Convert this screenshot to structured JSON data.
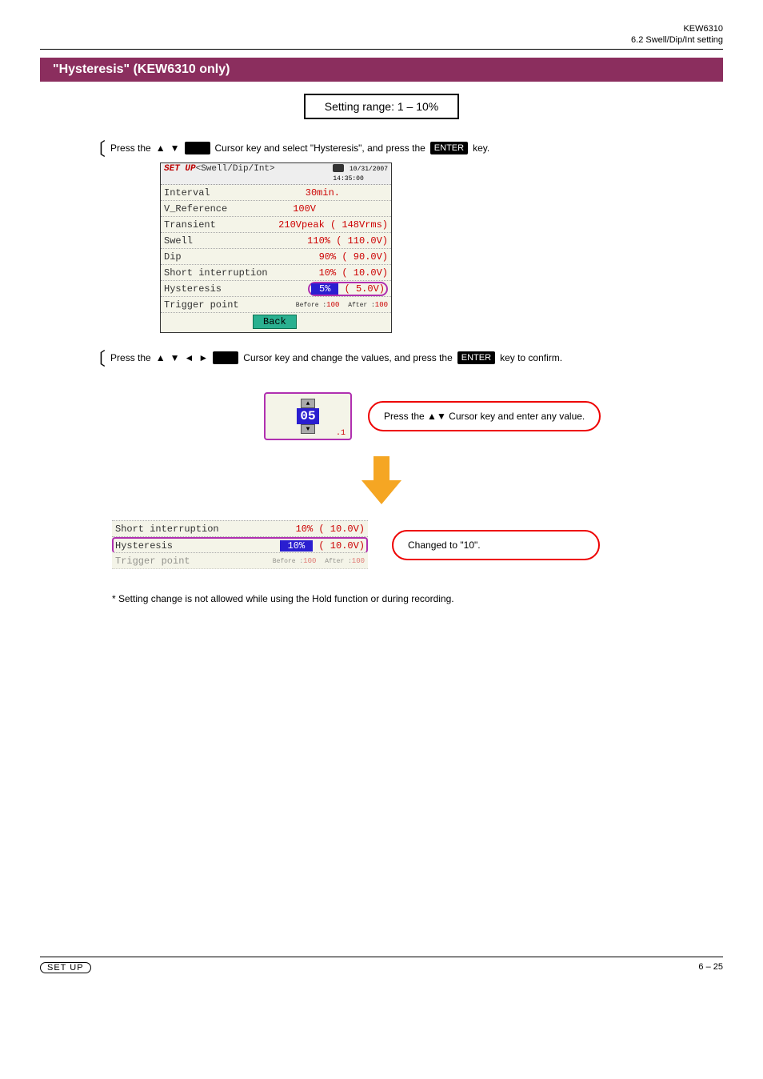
{
  "header": {
    "chapter_right": "KEW6310",
    "breadcrumb_right": "6.2 Swell/Dip/Int setting"
  },
  "section": {
    "title": "\"Hysteresis\" (KEW6310 only)",
    "box_text": "Setting range: 1 – 10%"
  },
  "step1": {
    "text_a": "Press the",
    "text_b": "Cursor key and select \"Hysteresis\", and press the",
    "text_c": "key."
  },
  "lcd1": {
    "title_a": "SET UP",
    "title_b": "<Swell/Dip/Int>",
    "date": "10/31/2007",
    "time": "14:35:00",
    "rows": [
      {
        "name": "Interval",
        "val": "30min."
      },
      {
        "name": "V_Reference",
        "val": "100V"
      },
      {
        "name": "Transient",
        "val": "210Vpeak ( 148Vrms)"
      },
      {
        "name": "Swell",
        "pct": "110%",
        "paren": "( 110.0V)"
      },
      {
        "name": "Dip",
        "pct": "90%",
        "paren": "(  90.0V)"
      },
      {
        "name": "Short interruption",
        "pct": "10%",
        "paren": "(  10.0V)"
      },
      {
        "name": "Hysteresis",
        "pct": "5%",
        "paren": "(   5.0V)"
      },
      {
        "name": "Trigger point",
        "before_lbl": "Before :",
        "before_val": "100",
        "after_lbl": "After :",
        "after_val": "100"
      }
    ],
    "back": "Back"
  },
  "step2": {
    "text_a": "Press the",
    "text_b": "Cursor key and change the values, and press the",
    "text_c": "key to confirm."
  },
  "callout1": {
    "text_a": "Press the",
    "text_b": "Cursor key and enter any value."
  },
  "digit": {
    "value": "05",
    "suffix": ".1"
  },
  "lcd2": {
    "rows": [
      {
        "name": "Short interruption",
        "pct": "10%",
        "paren": "(  10.0V)"
      },
      {
        "name": "Hysteresis",
        "pct": "10%",
        "paren": "(  10.0V)"
      },
      {
        "name": "Trigger point",
        "before_lbl": "Before :",
        "before_val": "100",
        "after_lbl": "After :",
        "after_val": "100"
      }
    ]
  },
  "callout2": {
    "text": "Changed to \"10\"."
  },
  "note": {
    "text": "* Setting change is not allowed while using the Hold function or during recording."
  },
  "footer": {
    "setup": "SET UP",
    "right": "6 – 25"
  },
  "keys": {
    "enter": "ENTER"
  }
}
